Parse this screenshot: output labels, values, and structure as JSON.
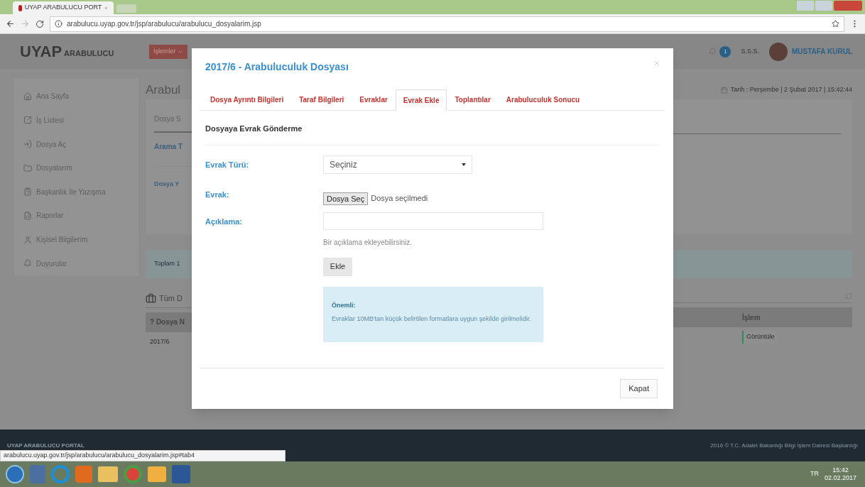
{
  "browser": {
    "tab_title": "UYAP ARABULUCU PORT",
    "url": "arabulucu.uyap.gov.tr/jsp/arabulucu/arabulucu_dosyalarim.jsp",
    "status_url": "arabulucu.uyap.gov.tr/jsp/arabulucu/arabulucu_dosyalarim.jsp#tab4"
  },
  "header": {
    "logo_main": "UYAP",
    "logo_sub": "ARABULUCU",
    "menu_button": "İşlemler",
    "notification_count": "1",
    "faq": "S.S.S.",
    "user": "MUSTAFA KURUL"
  },
  "sidebar": {
    "items": [
      {
        "label": "Ana Sayfa"
      },
      {
        "label": "İş Listesi"
      },
      {
        "label": "Dosya Aç"
      },
      {
        "label": "Dosyalarım"
      },
      {
        "label": "Başkanlık İle Yazışma"
      },
      {
        "label": "Raporlar"
      },
      {
        "label": "Kişisel Bilgilerim"
      },
      {
        "label": "Duyurular"
      }
    ]
  },
  "background": {
    "title": "Arabul",
    "tab": "Dosya S",
    "search_label": "Arama T",
    "file_label": "Dosya Y",
    "total": "Toplam 1",
    "list_title": "Tüm D",
    "date": "Tarih : Perşembe | 2 Şubat 2017 | 15:42:44",
    "table": {
      "columns": [
        "? Dosya N",
        "İşlem"
      ],
      "rows": [
        {
          "cells": [
            "2017/6"
          ],
          "action": "Görüntüle"
        }
      ]
    }
  },
  "modal": {
    "title": "2017/6 - Arabuluculuk Dosyası",
    "tabs": [
      {
        "label": "Dosya Ayrıntı Bilgileri",
        "selected": false
      },
      {
        "label": "Taraf Bilgileri",
        "selected": false
      },
      {
        "label": "Evraklar",
        "selected": false
      },
      {
        "label": "Evrak Ekle",
        "selected": true
      },
      {
        "label": "Toplantılar",
        "selected": false
      },
      {
        "label": "Arabuluculuk Sonucu",
        "selected": false
      }
    ],
    "heading": "Dosyaya Evrak Gönderme",
    "fields": [
      {
        "kind": "select",
        "label": "Evrak Türü:",
        "value": "Seçiniz"
      },
      {
        "kind": "file",
        "label": "Evrak:",
        "button": "Dosya Seç",
        "value": "Dosya seçilmedi"
      },
      {
        "kind": "text",
        "label": "Açıklama:",
        "help": "Bir açıklama ekleyebilirsiniz."
      }
    ],
    "submit": "Ekle",
    "notice": {
      "title": "Önemli:",
      "text": "Evraklar 10MB'tan küçük belirtilen formatlara uygun şekilde girilmelidir."
    },
    "close": "Kapat"
  },
  "footer": {
    "left": "UYAP ARABULUCU PORTAL",
    "right": "2016 © T.C. Adalet Bakanlığı Bilgi İşlem Dairesi Başkanlığı"
  },
  "taskbar": {
    "language": "TR",
    "time": "15:42",
    "date": "02.02.2017"
  }
}
